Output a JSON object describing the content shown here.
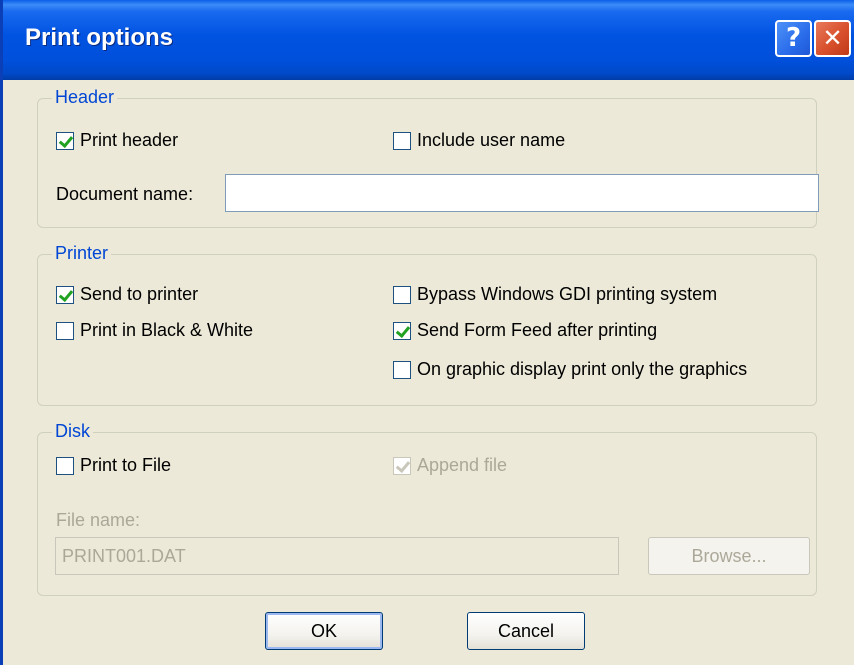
{
  "window": {
    "title": "Print options",
    "help_glyph": "?",
    "close_glyph": "✕"
  },
  "header_group": {
    "legend": "Header",
    "print_header": {
      "label": "Print header",
      "checked": true
    },
    "include_user_name": {
      "label": "Include user name",
      "checked": false
    },
    "document_name_label": "Document name:",
    "document_name_value": ""
  },
  "printer_group": {
    "legend": "Printer",
    "send_to_printer": {
      "label": "Send to printer",
      "checked": true
    },
    "black_white": {
      "label": "Print in Black & White",
      "checked": false
    },
    "bypass_gdi": {
      "label": "Bypass Windows GDI printing system",
      "checked": false
    },
    "form_feed": {
      "label": "Send Form Feed after printing",
      "checked": true
    },
    "graphics_only": {
      "label": "On graphic display print only the graphics",
      "checked": false
    }
  },
  "disk_group": {
    "legend": "Disk",
    "print_to_file": {
      "label": "Print to File",
      "checked": false
    },
    "append_file": {
      "label": "Append file",
      "checked": true,
      "disabled": true
    },
    "file_name_label": "File name:",
    "file_name_value": "PRINT001.DAT",
    "browse_label": "Browse..."
  },
  "footer": {
    "ok_label": "OK",
    "cancel_label": "Cancel"
  },
  "colors": {
    "titlebar": "#0054E3",
    "legend_text": "#0046D5",
    "check_mark": "#21A121",
    "dialog_bg": "#ECE9D8"
  },
  "icons": {
    "help": "help-icon",
    "close": "close-icon",
    "check": "checkmark-icon"
  }
}
